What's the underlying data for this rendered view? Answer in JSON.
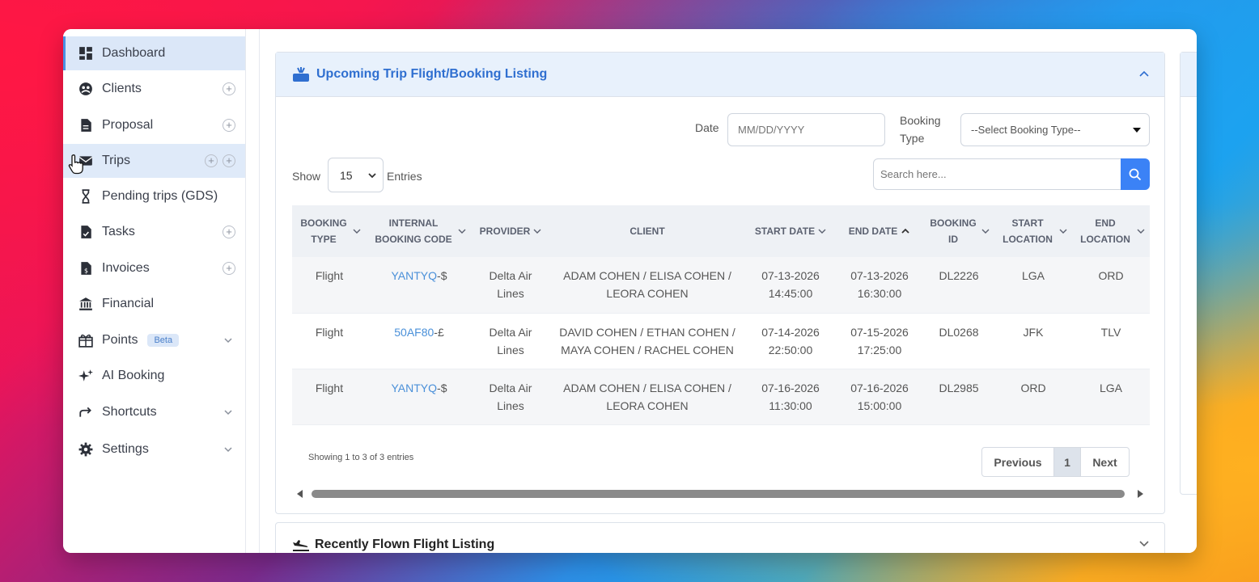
{
  "sidebar": {
    "items": [
      {
        "label": "Dashboard",
        "icon": "dashboard-icon"
      },
      {
        "label": "Clients",
        "icon": "clients-icon"
      },
      {
        "label": "Proposal",
        "icon": "document-icon"
      },
      {
        "label": "Trips",
        "icon": "trips-icon"
      },
      {
        "label": "Pending trips (GDS)",
        "icon": "hourglass-icon"
      },
      {
        "label": "Tasks",
        "icon": "tasks-icon"
      },
      {
        "label": "Invoices",
        "icon": "invoice-icon"
      },
      {
        "label": "Financial",
        "icon": "bank-icon"
      },
      {
        "label": "Points",
        "icon": "points-icon",
        "badge": "Beta"
      },
      {
        "label": "AI Booking",
        "icon": "sparkle-icon"
      },
      {
        "label": "Shortcuts",
        "icon": "share-arrow-icon"
      },
      {
        "label": "Settings",
        "icon": "gear-icon"
      }
    ],
    "plus_symbol": "+"
  },
  "upcoming": {
    "title": "Upcoming Trip Flight/Booking Listing",
    "date_label": "Date",
    "date_placeholder": "MM/DD/YYYY",
    "booking_type_label": "Booking Type",
    "booking_type_value": "--Select Booking Type--",
    "show_label": "Show",
    "entries_value": "15",
    "entries_label": "Entries",
    "search_placeholder": "Search here...",
    "columns": [
      "BOOKING TYPE",
      "INTERNAL BOOKING CODE",
      "PROVIDER",
      "CLIENT",
      "START DATE",
      "END DATE",
      "BOOKING ID",
      "START LOCATION",
      "END LOCATION"
    ],
    "rows": [
      {
        "type": "Flight",
        "code": "YANTYQ",
        "code_suffix": "-$",
        "provider": "Delta Air Lines",
        "client": "ADAM COHEN / ELISA COHEN / LEORA COHEN",
        "start_date": "07-13-2026",
        "start_time": "14:45:00",
        "end_date": "07-13-2026",
        "end_time": "16:30:00",
        "booking_id": "DL2226",
        "start_loc": "LGA",
        "end_loc": "ORD"
      },
      {
        "type": "Flight",
        "code": "50AF80",
        "code_suffix": "-£",
        "provider": "Delta Air Lines",
        "client": "DAVID COHEN / ETHAN COHEN / MAYA COHEN / RACHEL COHEN",
        "start_date": "07-14-2026",
        "start_time": "22:50:00",
        "end_date": "07-15-2026",
        "end_time": "17:25:00",
        "booking_id": "DL0268",
        "start_loc": "JFK",
        "end_loc": "TLV"
      },
      {
        "type": "Flight",
        "code": "YANTYQ",
        "code_suffix": "-$",
        "provider": "Delta Air Lines",
        "client": "ADAM COHEN / ELISA COHEN / LEORA COHEN",
        "start_date": "07-16-2026",
        "start_time": "11:30:00",
        "end_date": "07-16-2026",
        "end_time": "15:00:00",
        "booking_id": "DL2985",
        "start_loc": "ORD",
        "end_loc": "LGA"
      }
    ],
    "showing_text": "Showing 1 to 3 of 3 entries",
    "pager": {
      "previous": "Previous",
      "page": "1",
      "next": "Next"
    }
  },
  "recent": {
    "title": "Recently Flown Flight Listing"
  },
  "colors": {
    "accent": "#2f6fd0",
    "link": "#4a90d9",
    "search_button": "#3b82f6",
    "active_bg": "#dbe7f8"
  }
}
